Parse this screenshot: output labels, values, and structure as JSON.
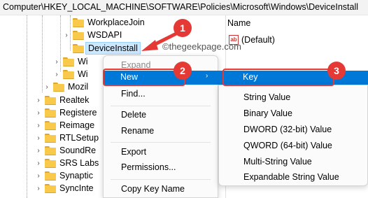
{
  "address": "Computer\\HKEY_LOCAL_MACHINE\\SOFTWARE\\Policies\\Microsoft\\Windows\\DeviceInstall",
  "tree": {
    "workplace_join": "WorkplaceJoin",
    "wsdapi": "WSDAPI",
    "device_install": "DeviceInstall",
    "wi1": "Wi",
    "wi2": "Wi",
    "mozilla": "Mozil",
    "realtek": "Realtek",
    "registered": "Registere",
    "reimage": "Reimage",
    "rtlsetup": "RTLSetup",
    "soundre": "SoundRe",
    "srslabs": "SRS Labs",
    "synaptics": "Synaptic",
    "syncinte": "SyncInte"
  },
  "values_pane": {
    "col_name": "Name",
    "default_value": "(Default)",
    "watermark": "©thegeekpage.com"
  },
  "context_menu": {
    "expand": "Expand",
    "new": "New",
    "find": "Find...",
    "delete": "Delete",
    "rename": "Rename",
    "export": "Export",
    "permissions": "Permissions...",
    "copy_key_name": "Copy Key Name"
  },
  "submenu": {
    "key": "Key",
    "string_value": "String Value",
    "binary_value": "Binary Value",
    "dword": "DWORD (32-bit) Value",
    "qword": "QWORD (64-bit) Value",
    "multi_string": "Multi-String Value",
    "expandable_string": "Expandable String Value"
  },
  "annotations": {
    "step1": "1",
    "step2": "2",
    "step3": "3",
    "color": "#e53935"
  },
  "colors": {
    "highlight": "#0078d7",
    "folder": "#f8c94a",
    "selected_bg": "#cce8ff"
  }
}
